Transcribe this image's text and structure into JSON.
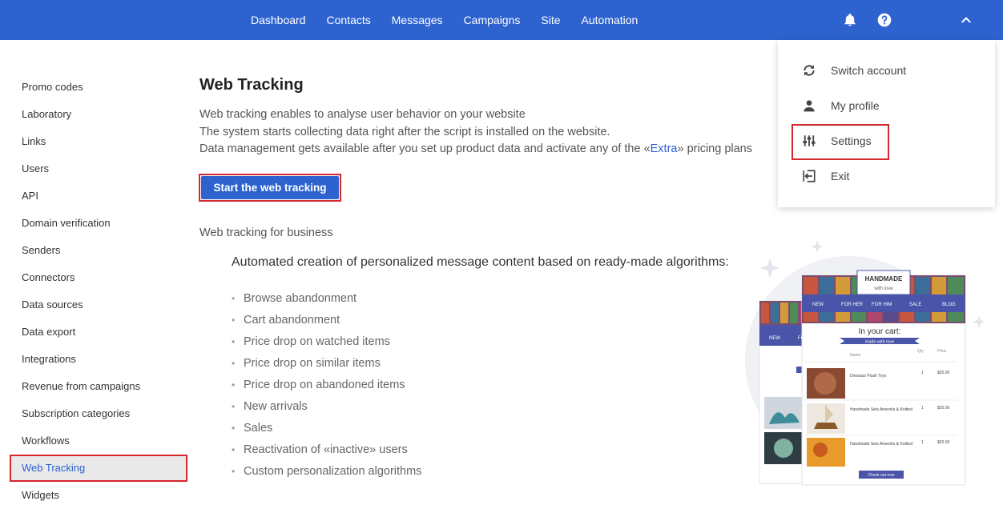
{
  "nav": {
    "items": [
      "Dashboard",
      "Contacts",
      "Messages",
      "Campaigns",
      "Site",
      "Automation"
    ]
  },
  "header_icons": [
    "bell-icon",
    "help-icon",
    "chevron-up-icon"
  ],
  "sidebar": {
    "items": [
      {
        "label": "Promo codes"
      },
      {
        "label": "Laboratory"
      },
      {
        "label": "Links"
      },
      {
        "label": "Users"
      },
      {
        "label": "API"
      },
      {
        "label": "Domain verification"
      },
      {
        "label": "Senders"
      },
      {
        "label": "Connectors"
      },
      {
        "label": "Data sources"
      },
      {
        "label": "Data export"
      },
      {
        "label": "Integrations"
      },
      {
        "label": "Revenue from campaigns"
      },
      {
        "label": "Subscription categories"
      },
      {
        "label": "Workflows"
      },
      {
        "label": "Web Tracking",
        "active": true
      },
      {
        "label": "Widgets"
      }
    ]
  },
  "main": {
    "title": "Web Tracking",
    "intro": {
      "line1": "Web tracking enables to analyse user behavior on your website",
      "line2": "The system starts collecting data right after the script is installed on the website.",
      "line3_before": "Data management gets available after you set up product data and activate any of the «",
      "line3_link": "Extra",
      "line3_after": "» pricing plans"
    },
    "start_button": "Start the web tracking",
    "sub_heading": "Web tracking for business",
    "algo_heading": "Automated creation of personalized message content based on ready-made algorithms:",
    "features": [
      "Browse abandonment",
      "Cart abandonment",
      "Price drop on watched items",
      "Price drop on similar items",
      "Price drop on abandoned items",
      "New arrivals",
      "Sales",
      "Reactivation of «inactive» users",
      "Custom personalization algorithms"
    ]
  },
  "dropdown": {
    "items": [
      {
        "label": "Switch account",
        "icon": "refresh-icon"
      },
      {
        "label": "My profile",
        "icon": "user-icon"
      },
      {
        "label": "Settings",
        "icon": "sliders-icon"
      },
      {
        "label": "Exit",
        "icon": "exit-icon"
      }
    ]
  },
  "illustration": {
    "logo_line1": "HANDMADE",
    "logo_line2": "with love",
    "nav": [
      "NEW",
      "FOR HER",
      "FOR HIM",
      "SALE",
      "BLOG"
    ],
    "back_nav": [
      "NEW",
      "FO"
    ],
    "cart_title": "In your cart:",
    "cart_subtitle": "made with love",
    "cols": [
      "Name",
      "Qty",
      "Price"
    ],
    "rows": [
      {
        "name": "Dinosaur Plush Toys",
        "qty": "1",
        "price": "$20.00"
      },
      {
        "name": "Handmade Sets Artworks & Knitted",
        "qty": "1",
        "price": "$20.00"
      },
      {
        "name": "Handmade Sets Artworks & Knitted",
        "qty": "1",
        "price": "$20.00"
      }
    ],
    "checkout": "Check out now",
    "colors": {
      "accent": "#4a54a8",
      "brand": "#2d62cf",
      "highlight": "#d6262e"
    }
  }
}
